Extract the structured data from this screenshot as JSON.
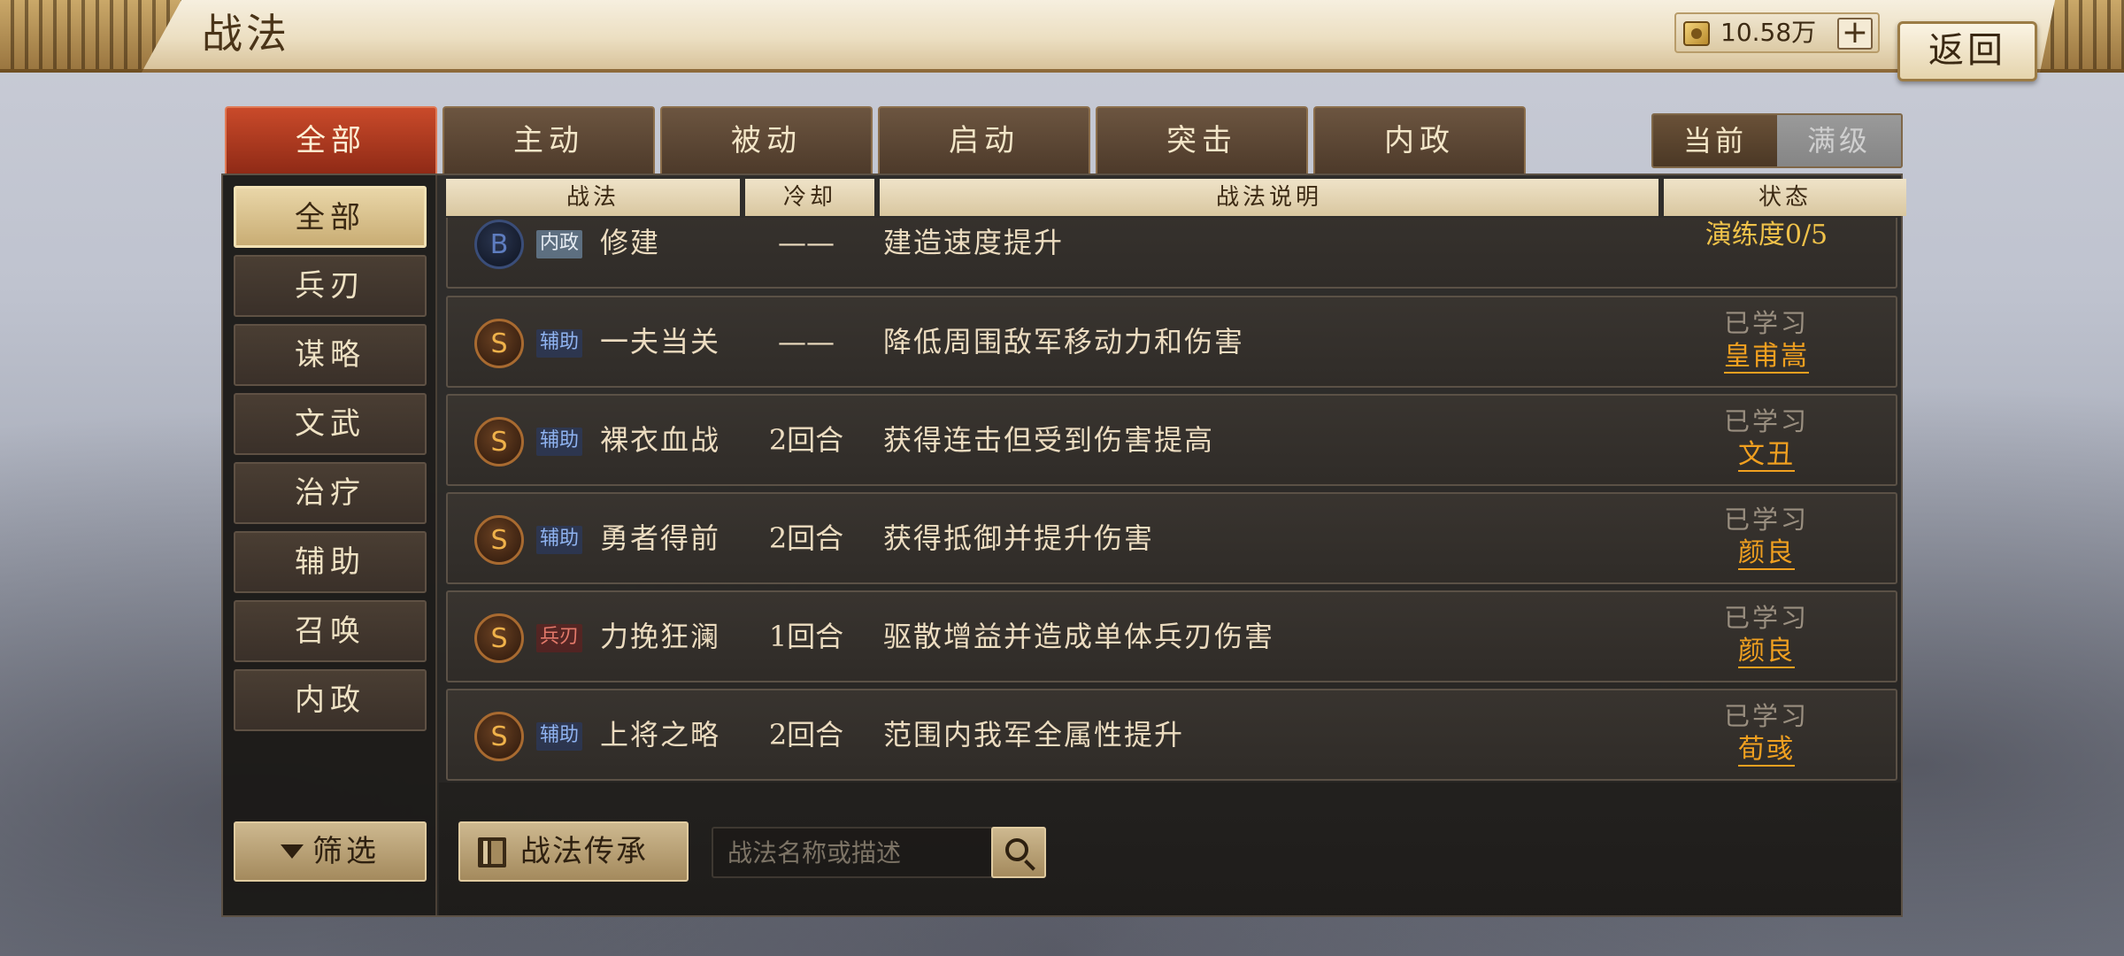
{
  "header": {
    "title": "战法",
    "currency": {
      "icon": "coin-icon",
      "value": "10.58万"
    },
    "add_label": "+",
    "back_label": "返回"
  },
  "tabs": [
    {
      "label": "全部",
      "active": true
    },
    {
      "label": "主动",
      "active": false
    },
    {
      "label": "被动",
      "active": false
    },
    {
      "label": "启动",
      "active": false
    },
    {
      "label": "突击",
      "active": false
    },
    {
      "label": "内政",
      "active": false
    }
  ],
  "level_toggle": {
    "current": "当前",
    "max": "满级",
    "selected": "当前"
  },
  "sidebar": {
    "items": [
      {
        "label": "全部",
        "active": true
      },
      {
        "label": "兵刃"
      },
      {
        "label": "谋略"
      },
      {
        "label": "文武"
      },
      {
        "label": "治疗"
      },
      {
        "label": "辅助"
      },
      {
        "label": "召唤"
      },
      {
        "label": "内政"
      }
    ],
    "filter_label": "筛选"
  },
  "table": {
    "columns": [
      "战法",
      "冷却",
      "战法说明",
      "状态"
    ],
    "rows": [
      {
        "rank": "B",
        "tag": "内政",
        "name": "修建",
        "cooldown": "——",
        "desc": "建造速度提升",
        "status": "演练度0/5"
      },
      {
        "rank": "S",
        "tag": "辅助",
        "name": "一夫当关",
        "cooldown": "——",
        "desc": "降低周围敌军移动力和伤害",
        "status": "已学习",
        "hero": "皇甫嵩"
      },
      {
        "rank": "S",
        "tag": "辅助",
        "name": "裸衣血战",
        "cooldown": "2回合",
        "desc": "获得连击但受到伤害提高",
        "status": "已学习",
        "hero": "文丑"
      },
      {
        "rank": "S",
        "tag": "辅助",
        "name": "勇者得前",
        "cooldown": "2回合",
        "desc": "获得抵御并提升伤害",
        "status": "已学习",
        "hero": "颜良"
      },
      {
        "rank": "S",
        "tag": "兵刃",
        "name": "力挽狂澜",
        "cooldown": "1回合",
        "desc": "驱散增益并造成单体兵刃伤害",
        "status": "已学习",
        "hero": "颜良"
      },
      {
        "rank": "S",
        "tag": "辅助",
        "name": "上将之略",
        "cooldown": "2回合",
        "desc": "范围内我军全属性提升",
        "status": "已学习",
        "hero": "荀彧"
      }
    ]
  },
  "bottom": {
    "inherit_label": "战法传承",
    "search_placeholder": "战法名称或描述",
    "search_value": ""
  }
}
